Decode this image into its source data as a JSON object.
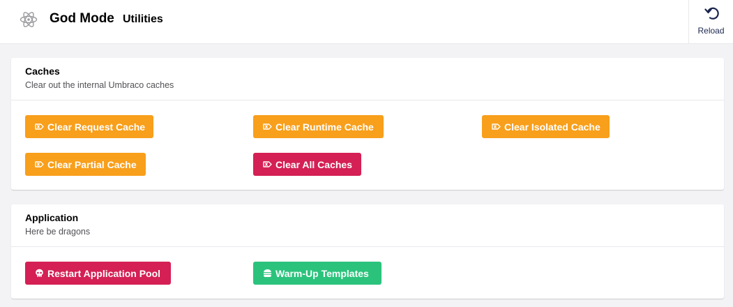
{
  "header": {
    "app_icon": "atom-icon",
    "app_title": "God Mode",
    "page_title": "Utilities",
    "reload": {
      "icon": "reload-icon",
      "label": "Reload"
    }
  },
  "caches": {
    "title": "Caches",
    "description": "Clear out the internal Umbraco caches",
    "buttons": {
      "request": {
        "label": "Clear Request Cache",
        "icon": "eraser-icon",
        "color": "#f89f1b"
      },
      "runtime": {
        "label": "Clear Runtime Cache",
        "icon": "eraser-icon",
        "color": "#f89f1b"
      },
      "isolated": {
        "label": "Clear Isolated Cache",
        "icon": "eraser-icon",
        "color": "#f89f1b"
      },
      "partial": {
        "label": "Clear Partial Cache",
        "icon": "eraser-icon",
        "color": "#f89f1b"
      },
      "all": {
        "label": "Clear All Caches",
        "icon": "eraser-icon",
        "color": "#d42054"
      }
    }
  },
  "application": {
    "title": "Application",
    "description": "Here be dragons",
    "buttons": {
      "restart": {
        "label": "Restart Application Pool",
        "icon": "skull-icon",
        "color": "#d42054"
      },
      "warmup": {
        "label": "Warm-Up Templates",
        "icon": "burger-icon",
        "color": "#2bc37c"
      }
    }
  }
}
